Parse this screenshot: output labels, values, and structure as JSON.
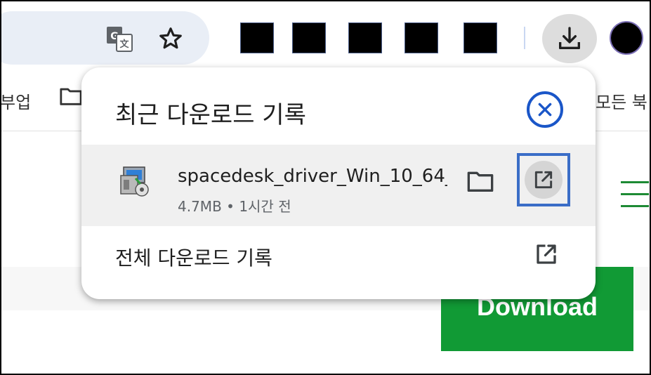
{
  "toolbar": {
    "translate_icon": "translate-icon",
    "star_icon": "bookmark-star-icon",
    "extension_count": 5,
    "download_icon": "download-icon",
    "profile_icon": "avatar"
  },
  "bookmarks": {
    "left_item": "부업",
    "right_item": "모든 북"
  },
  "popup": {
    "title": "최근 다운로드 기록",
    "close_icon": "close-circle-icon",
    "items": [
      {
        "file_name": "spacedesk_driver_Win_10_64_",
        "size": "4.7MB",
        "separator": "•",
        "time": "1시간 전",
        "file_icon": "installer-icon",
        "folder_icon": "folder-icon",
        "open_icon": "open-external-icon"
      }
    ],
    "all_downloads_label": "전체 다운로드 기록",
    "all_downloads_icon": "open-external-icon"
  },
  "page": {
    "download_button_label": "Download",
    "download_button_color": "#119a35",
    "highlight_color": "#3a6dc7",
    "close_accent_color": "#1a56c8"
  }
}
